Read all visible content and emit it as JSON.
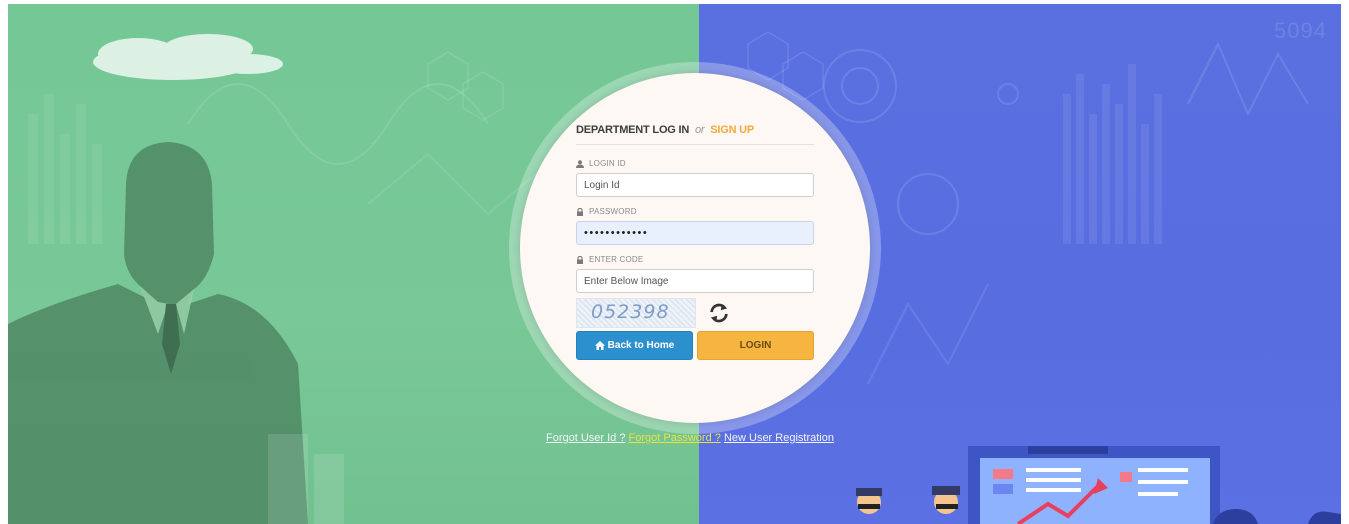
{
  "background": {
    "corner_number": "5094"
  },
  "form": {
    "title": "DEPARTMENT LOG IN",
    "or_text": "or",
    "signup_label": "SIGN UP",
    "login_id_label": "LOGIN ID",
    "login_id_placeholder": "Login Id",
    "password_label": "PASSWORD",
    "password_value": "••••••••••••",
    "code_label": "ENTER CODE",
    "code_placeholder": "Enter Below Image",
    "captcha_text": "052398",
    "back_button_label": "Back to Home",
    "login_button_label": "LOGIN"
  },
  "links": {
    "forgot_user": "Forgot User Id ?",
    "forgot_password": "Forgot Password ?",
    "new_user": "New User Registration"
  },
  "colors": {
    "left_bg": "#74c896",
    "right_bg": "#5a6fe0",
    "accent_orange": "#f2a93b",
    "button_blue": "#2c8fce",
    "button_yellow": "#f6b540"
  }
}
